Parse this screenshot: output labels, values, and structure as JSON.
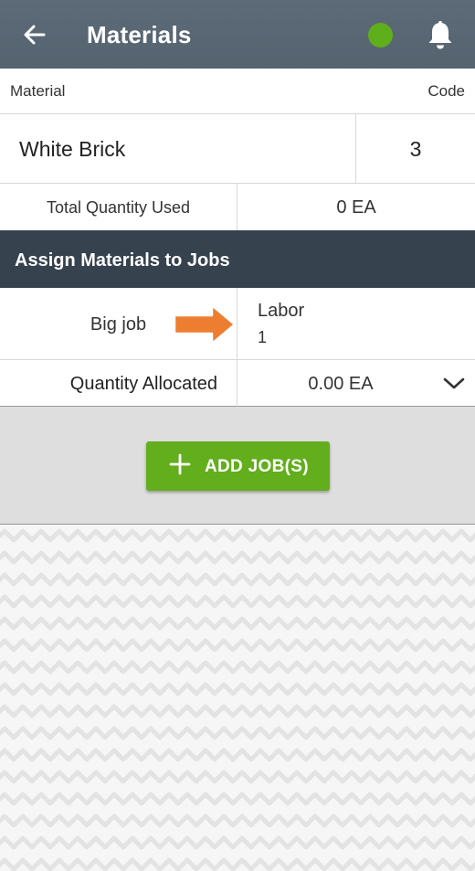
{
  "header": {
    "title": "Materials",
    "back_icon": "arrow-left-icon",
    "status_color": "#5fae1b",
    "bell_icon": "bell-icon"
  },
  "columns": {
    "material_label": "Material",
    "code_label": "Code"
  },
  "material": {
    "name": "White Brick",
    "code": "3"
  },
  "total": {
    "label": "Total Quantity Used",
    "value": "0 EA"
  },
  "assign_section": {
    "title": "Assign Materials to Jobs",
    "job": {
      "name": "Big job",
      "type": "Labor",
      "number": "1"
    },
    "allocation": {
      "label": "Quantity Allocated",
      "value": "0.00 EA"
    }
  },
  "actions": {
    "add_jobs_label": "ADD JOB(S)",
    "accent_color": "#62ae1c"
  },
  "annotation": {
    "arrow_color": "#ed7d31"
  }
}
